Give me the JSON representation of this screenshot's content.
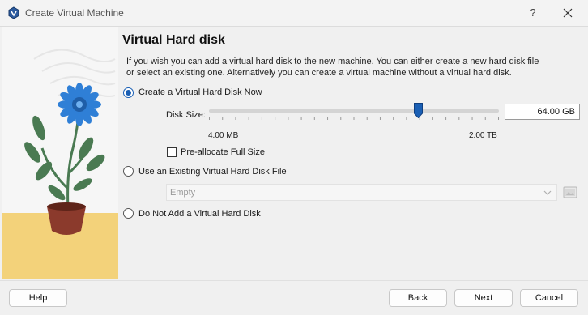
{
  "window": {
    "title": "Create Virtual Machine",
    "help_glyph": "?"
  },
  "page": {
    "heading": "Virtual Hard disk",
    "description": "If you wish you can add a virtual hard disk to the new machine. You can either create a new hard disk file or select an existing one. Alternatively you can create a virtual machine without a virtual hard disk."
  },
  "options": {
    "create_now": {
      "label": "Create a Virtual Hard Disk Now",
      "selected": true
    },
    "use_existing": {
      "label": "Use an Existing Virtual Hard Disk File",
      "selected": false
    },
    "no_disk": {
      "label": "Do Not Add a Virtual Hard Disk",
      "selected": false
    }
  },
  "disk": {
    "size_label": "Disk Size:",
    "size_value": "64.00 GB",
    "min_label": "4.00 MB",
    "max_label": "2.00 TB",
    "slider_fraction": 0.72,
    "preallocate_label": "Pre-allocate Full Size",
    "preallocate_checked": false
  },
  "existing": {
    "combo_value": "Empty"
  },
  "buttons": {
    "help": "Help",
    "back": "Back",
    "next": "Next",
    "cancel": "Cancel"
  },
  "colors": {
    "accent": "#1a5fb4",
    "pot": "#8b3a2c",
    "flower": "#2f7fd6",
    "leaf": "#4a7a52",
    "ground": "#f3d27a"
  },
  "icons": [
    "virtualbox-logo-icon",
    "help-icon",
    "close-icon",
    "slider-handle-icon",
    "chevron-down-icon",
    "folder-icon"
  ]
}
